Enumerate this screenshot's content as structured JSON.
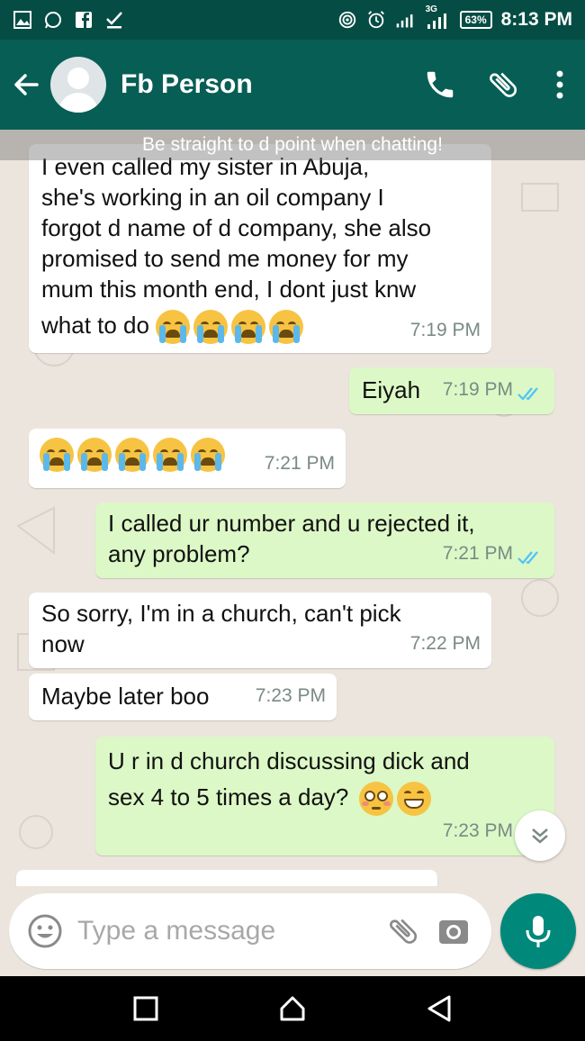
{
  "status_bar": {
    "time": "8:13 PM",
    "battery": "63%",
    "network": "3G"
  },
  "header": {
    "contact_name": "Fb Person"
  },
  "banner": {
    "text": "Be straight to d point when chatting!"
  },
  "messages": [
    {
      "direction": "in",
      "lines": [
        "I even called my sister in Abuja,",
        "she's working in an oil company I",
        "forgot d name of d company, she also",
        "promised to send me money for my",
        "mum this month end, I dont just knw",
        "what to do"
      ],
      "emojis": 4,
      "time": "7:19 PM"
    },
    {
      "direction": "out",
      "text": "Eiyah",
      "time": "7:19 PM",
      "ticks": "read"
    },
    {
      "direction": "in",
      "text": "",
      "emojis": 5,
      "time": "7:21 PM"
    },
    {
      "direction": "out",
      "lines": [
        "I called ur number and u rejected it,",
        "any problem?"
      ],
      "time": "7:21 PM",
      "ticks": "read"
    },
    {
      "direction": "in",
      "lines": [
        "So sorry, I'm in a church, can't pick",
        "now"
      ],
      "time": "7:22 PM"
    },
    {
      "direction": "in",
      "text": "Maybe later boo",
      "time": "7:23 PM"
    },
    {
      "direction": "out",
      "lines": [
        "U r in d church discussing dick and",
        "sex 4 to 5 times a day?"
      ],
      "time": "7:23 PM"
    }
  ],
  "input": {
    "placeholder": "Type a message"
  },
  "colors": {
    "header": "#075e54",
    "status": "#054d44",
    "outgoing": "#dcf8c6",
    "incoming": "#ffffff",
    "accent": "#00897b",
    "ticks": "#4fc3f7"
  }
}
